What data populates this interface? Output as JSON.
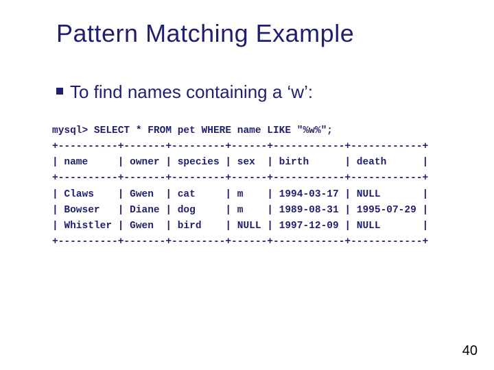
{
  "title": "Pattern Matching Example",
  "bullet": "To find names containing a ‘w’:",
  "page_number": "40",
  "query": "mysql> SELECT * FROM pet WHERE name LIKE \"%w%\";",
  "table": {
    "border": "+----------+-------+---------+------+------------+------------+",
    "header": "| name     | owner | species | sex  | birth      | death      |",
    "rows": [
      "| Claws    | Gwen  | cat     | m    | 1994-03-17 | NULL       |",
      "| Bowser   | Diane | dog     | m    | 1989-08-31 | 1995-07-29 |",
      "| Whistler | Gwen  | bird    | NULL | 1997-12-09 | NULL       |"
    ]
  }
}
